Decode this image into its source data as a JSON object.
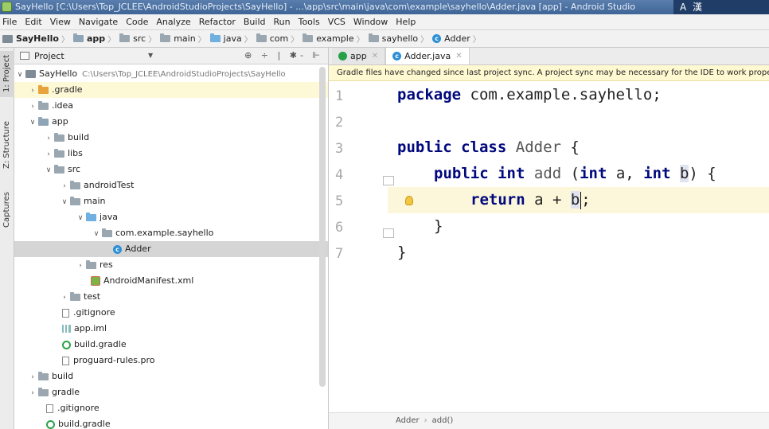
{
  "window": {
    "title": "SayHello [C:\\Users\\Top_JCLEE\\AndroidStudioProjects\\SayHello] - ...\\app\\src\\main\\java\\com\\example\\sayhello\\Adder.java [app] - Android Studio",
    "ime": "A 漢"
  },
  "menu": [
    "File",
    "Edit",
    "View",
    "Navigate",
    "Code",
    "Analyze",
    "Refactor",
    "Build",
    "Run",
    "Tools",
    "VCS",
    "Window",
    "Help"
  ],
  "breadcrumb": [
    "SayHello",
    "app",
    "src",
    "main",
    "java",
    "com",
    "example",
    "sayhello",
    "Adder"
  ],
  "tool_windows": {
    "project": "1: Project",
    "structure": "Z: Structure",
    "captures": "Captures"
  },
  "project_panel": {
    "title": "Project",
    "tools": "⊕ ÷ | ✱- ⊩",
    "root_label": "SayHello",
    "root_path": "C:\\Users\\Top_JCLEE\\AndroidStudioProjects\\SayHello",
    "items": [
      {
        "label": ".gradle"
      },
      {
        "label": ".idea"
      },
      {
        "label": "app"
      },
      {
        "label": "build"
      },
      {
        "label": "libs"
      },
      {
        "label": "src"
      },
      {
        "label": "androidTest"
      },
      {
        "label": "main"
      },
      {
        "label": "java"
      },
      {
        "label": "com.example.sayhello"
      },
      {
        "label": "Adder"
      },
      {
        "label": "res"
      },
      {
        "label": "AndroidManifest.xml"
      },
      {
        "label": "test"
      },
      {
        "label": ".gitignore"
      },
      {
        "label": "app.iml"
      },
      {
        "label": "build.gradle"
      },
      {
        "label": "proguard-rules.pro"
      },
      {
        "label": "build"
      },
      {
        "label": "gradle"
      },
      {
        "label": ".gitignore"
      },
      {
        "label": "build.gradle"
      }
    ]
  },
  "editor": {
    "tabs": [
      {
        "label": "app"
      },
      {
        "label": "Adder.java"
      }
    ],
    "banner": "Gradle files have changed since last project sync. A project sync may be necessary for the IDE to work properly.",
    "line_numbers": [
      "1",
      "2",
      "3",
      "4",
      "5",
      "6",
      "7"
    ],
    "code": {
      "l1_kw": "package",
      "l1_rest": " com.example.sayhello;",
      "l3_kw1": "public",
      "l3_kw2": "class",
      "l3_name": "Adder",
      "l3_brace": " {",
      "l4_kw1": "public",
      "l4_kw2": "int",
      "l4_name": "add",
      "l4_open": " (",
      "l4_kw3": "int",
      "l4_a": " a, ",
      "l4_kw4": "int",
      "l4_b": "b",
      "l4_close": ") {",
      "l5_kw": "return",
      "l5_expr": " a + ",
      "l5_b": "b",
      "l5_end": ";",
      "l6": "}",
      "l7": "}"
    },
    "status_path": [
      "Adder",
      "add()"
    ]
  }
}
